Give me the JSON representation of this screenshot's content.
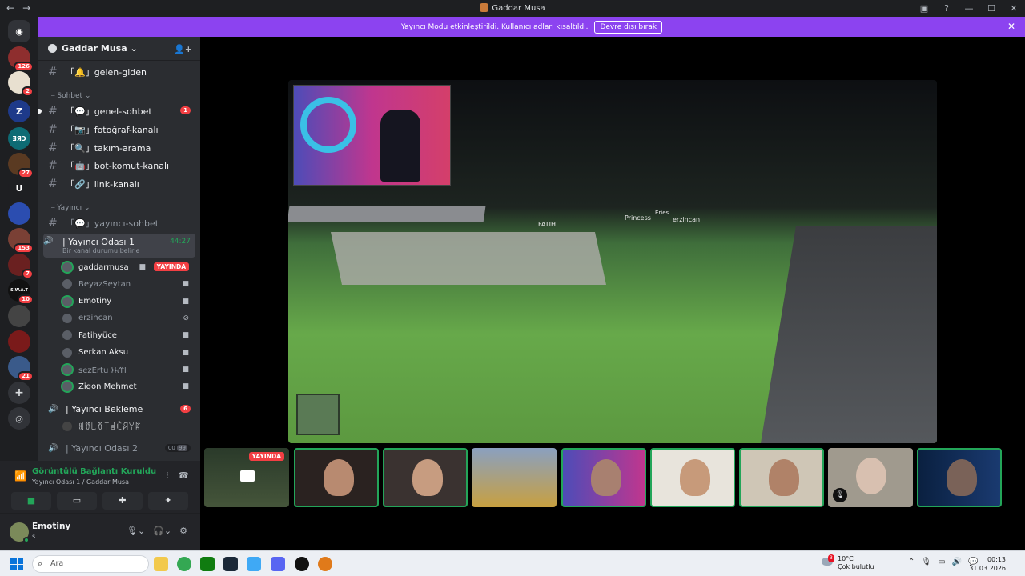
{
  "window": {
    "title": "Gaddar Musa"
  },
  "banner": {
    "text": "Yayıncı Modu etkinleştirildi. Kullanıcı adları kısaltıldı.",
    "button": "Devre dışı bırak"
  },
  "servers": [
    {
      "label": "",
      "badge": ""
    },
    {
      "label": "",
      "badge": "126"
    },
    {
      "label": "",
      "badge": "2"
    },
    {
      "label": "Z",
      "badge": ""
    },
    {
      "label": "ƎЯƆ",
      "badge": ""
    },
    {
      "label": "",
      "badge": "27"
    },
    {
      "label": "U",
      "badge": ""
    },
    {
      "label": "",
      "badge": ""
    },
    {
      "label": "",
      "badge": "153"
    },
    {
      "label": "",
      "badge": "7"
    },
    {
      "label": "S.W.A.T",
      "badge": "10"
    },
    {
      "label": "",
      "badge": ""
    },
    {
      "label": "",
      "badge": ""
    },
    {
      "label": "",
      "badge": "21"
    }
  ],
  "guild": {
    "name": "Gaddar Musa"
  },
  "channels": {
    "gelen": "「🔔」gelen-giden",
    "cat_sohbet": "Sohbet",
    "genel": "「💬」genel-sohbet",
    "genel_badge": "1",
    "foto": "「📷」fotoğraf-kanalı",
    "takim": "「🔍」takım-arama",
    "bot": "「🤖」bot-komut-kanalı",
    "link": "「🔗」link-kanalı",
    "cat_yayinci": "Yayıncı",
    "yayinci_sohbet": "「💬」yayıncı-sohbet",
    "oda1": "| Yayıncı Odası 1",
    "oda1_time": "44:27",
    "oda1_status": "Bir kanal durumu belirle",
    "bekleme": "| Yayıncı Bekleme",
    "bekleme_badge": "6",
    "bekleme_user": "ꌃꀎ꒒ꀎ꓄ꀸꍟꋪꌩꍏ",
    "oda2": "| Yayıncı Odası 2",
    "oda2_count": "00",
    "oda2_limit": "99"
  },
  "voice_users": [
    {
      "name": "gaddarmusa",
      "live": "YAYINDA"
    },
    {
      "name": "BeyazSeytan"
    },
    {
      "name": "Emotiny"
    },
    {
      "name": "erzincan"
    },
    {
      "name": "Fatihyüce"
    },
    {
      "name": "Serkan Aksu"
    },
    {
      "name": "sezErtu 𐰾𐰼𐱅𐰆"
    },
    {
      "name": "Zigon Mehmet"
    }
  ],
  "connection": {
    "status": "Görüntülü Bağlantı Kuruldu",
    "sub": "Yayıncı Odası 1 / Gaddar Musa"
  },
  "user": {
    "name": "Emotiny",
    "status": "s..."
  },
  "stream": {
    "live": "YAYINDA",
    "names": [
      "FATIH",
      "Princess",
      "Eries",
      "erzincan"
    ]
  },
  "taskbar": {
    "search": "Ara",
    "temp": "10°C",
    "weather": "Çok bulutlu",
    "time": "00:13",
    "date": "31.03.2026",
    "weather_badge": "3"
  }
}
